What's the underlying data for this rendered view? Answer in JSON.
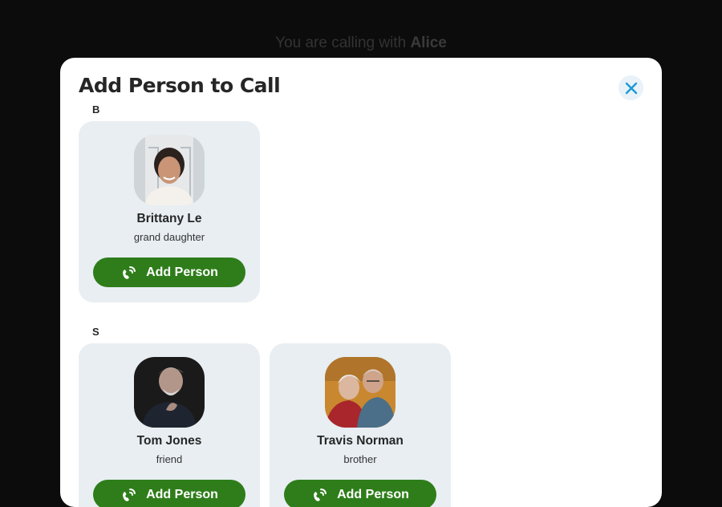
{
  "background": {
    "calling_prefix": "You are calling with",
    "calling_name": "Alice"
  },
  "modal": {
    "title": "Add Person to Call",
    "close_icon": "close-x-icon",
    "accent_color": "#1a9ad6",
    "button_color": "#2e7d1a"
  },
  "sections": [
    {
      "letter": "B",
      "contacts": [
        {
          "name": "Brittany Le",
          "relation": "grand daughter",
          "button_label": "Add Person",
          "button_icon": "phone-icon"
        }
      ]
    },
    {
      "letter": "S",
      "contacts": [
        {
          "name": "Tom Jones",
          "relation": "friend",
          "button_label": "Add Person",
          "button_icon": "phone-icon"
        },
        {
          "name": "Travis Norman",
          "relation": "brother",
          "button_label": "Add Person",
          "button_icon": "phone-icon"
        }
      ]
    }
  ]
}
